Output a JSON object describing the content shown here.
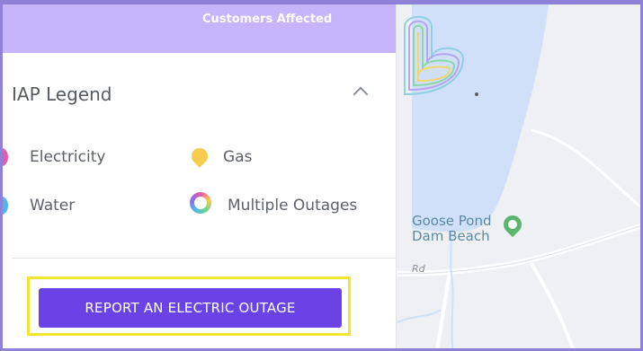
{
  "header": {
    "label": "Customers Affected"
  },
  "legend": {
    "title": "IAP Legend",
    "toggle_icon": "chevron-up-icon",
    "items": [
      {
        "label": "Electricity",
        "icon": "electricity-pin-icon",
        "color": "#e75aa8"
      },
      {
        "label": "Gas",
        "icon": "gas-pin-icon",
        "color": "#f6cd4c"
      },
      {
        "label": "Water",
        "icon": "water-pin-icon",
        "color": "#4fb8e8"
      },
      {
        "label": "Multiple Outages",
        "icon": "multiple-outages-ring-icon",
        "color": "gradient"
      }
    ]
  },
  "report_button": {
    "label": "REPORT AN ELECTRIC OUTAGE",
    "color": "#6a42e6"
  },
  "highlight_color": "#f2e531",
  "map": {
    "place_label_line1": "Goose Pond",
    "place_label_line2": "Dam Beach",
    "road_label": "Rd",
    "water_color": "#cfe0f8",
    "logo": "brand-heart-logo"
  }
}
